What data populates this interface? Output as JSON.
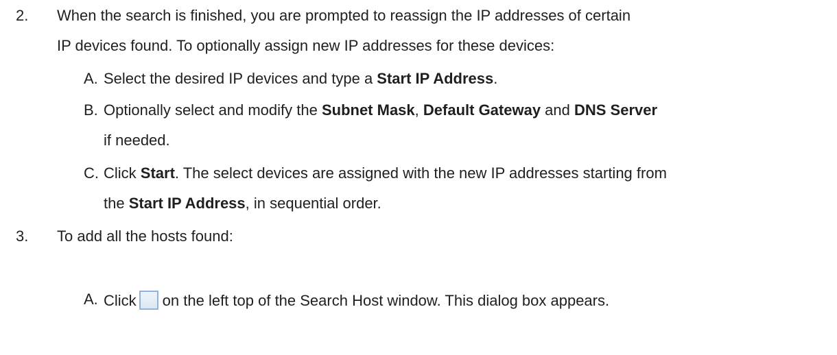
{
  "steps": [
    {
      "number": "2.",
      "lines": [
        "When the search is finished, you are prompted to reassign the IP addresses of certain",
        "IP devices found. To optionally assign new IP addresses for these devices:"
      ],
      "substeps": [
        {
          "letter": "A.",
          "line1_a": "Select the desired IP devices and type a ",
          "line1_b": "Start IP Address",
          "line1_c": "."
        },
        {
          "letter": "B.",
          "line1_a": "Optionally select and modify the ",
          "line1_b": "Subnet Mask",
          "line1_c": ", ",
          "line1_d": "Default Gateway",
          "line1_e": " and ",
          "line1_f": "DNS Server",
          "line2": "if needed."
        },
        {
          "letter": "C.",
          "line1_a": "Click ",
          "line1_b": "Start",
          "line1_c": ". The select devices are assigned with the new IP addresses starting from",
          "line2_a": "the ",
          "line2_b": "Start IP Address",
          "line2_c": ", in sequential order."
        }
      ]
    },
    {
      "number": "3.",
      "lines": [
        "To add all the hosts found:"
      ],
      "substeps": [
        {
          "letter": "A.",
          "line1_a": "Click",
          "icon": "checkbox-icon",
          "line1_b": "on the left top of the Search Host window. This dialog box appears."
        }
      ]
    }
  ]
}
